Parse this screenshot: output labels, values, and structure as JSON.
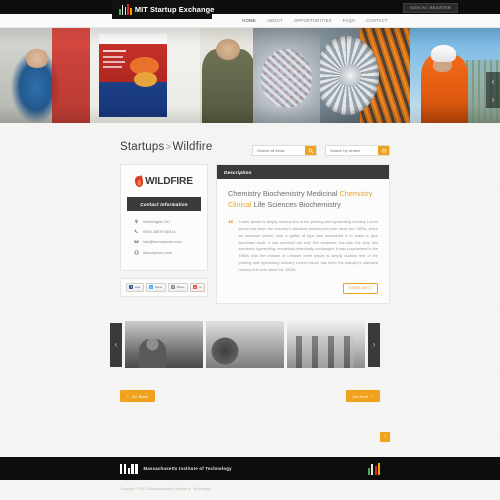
{
  "topbar": {
    "brand": "MIT Startup Exchange",
    "signin_label": "SIGN IN / REGISTER"
  },
  "nav": {
    "items": [
      {
        "label": "HOME",
        "active": true
      },
      {
        "label": "ABOUT",
        "active": false
      },
      {
        "label": "OPPORTUNITIES",
        "active": false
      },
      {
        "label": "FAQS",
        "active": false
      },
      {
        "label": "CONTACT",
        "active": false
      }
    ]
  },
  "hero": {
    "prev_icon": "‹",
    "next_icon": "›"
  },
  "page": {
    "breadcrumb_parent": "Startups",
    "breadcrumb_sep": ">",
    "breadcrumb_current": "Wildfire"
  },
  "search": {
    "all_fields_placeholder": "Search all fields",
    "all_fields_value": "",
    "cluster_placeholder": "Search by cluster",
    "cluster_value": ""
  },
  "company": {
    "logo_text": "WILDFIRE",
    "contact_header": "Contact Information",
    "contact": [
      {
        "icon": "location-pin-icon",
        "value": "Washington DC"
      },
      {
        "icon": "phone-icon",
        "value": "0054 26879 56314"
      },
      {
        "icon": "envelope-icon",
        "value": "info@loremipsum.com"
      },
      {
        "icon": "globe-icon",
        "value": "www.lipsum.com"
      }
    ]
  },
  "social": {
    "facebook_label": "Like",
    "twitter_label": "Tweet",
    "share_label": "Share",
    "googleplus_label": "+1"
  },
  "description": {
    "header": "Description",
    "tagline_before": "Chemistry Biochemistry Medicinal ",
    "tagline_highlight": "Chemistry Clinical",
    "tagline_after": " Life Sciences Biochemistry",
    "quote_mark": "“",
    "body": "Lorem Ipsum is simply dummy text of the printing and typesetting industry Lorem Ipsum has been the industry's standard dummy text ever since the 1500s, when an unknown printer took a galley of type and scrambled it to make a type specimen book. It has survived not only five centuries, but also the leap into electronic typesetting, remaining essentially unchanged. It was popularised in the 1960s with the release of Letraset orem ipsum is simply dummy text of the printing and typesetting industry Lorem Ipsum has been the industry's standard dummy text ever since the 1500s.",
    "more_label": "MORE INFO"
  },
  "gallery": {
    "prev_icon": "‹",
    "next_icon": "›",
    "items": [
      {
        "alt": "conference-audience-photo"
      },
      {
        "alt": "exhibition-booth-photo"
      },
      {
        "alt": "networking-session-photo"
      }
    ]
  },
  "pager": {
    "back_label": "Go Back",
    "back_chev": "‹",
    "next_label": "Go Next",
    "next_chev": "›"
  },
  "totop": {
    "icon": "↑"
  },
  "footer": {
    "institution": "Massachusetts Institute of Technology",
    "copyright": "Copyright © 2013 Massachusetts Institute of Technology"
  },
  "colors": {
    "accent": "#f0a11e",
    "dark": "#0d0d0d",
    "panel_header": "#3a3a3a",
    "flame_red": "#d6272e"
  }
}
